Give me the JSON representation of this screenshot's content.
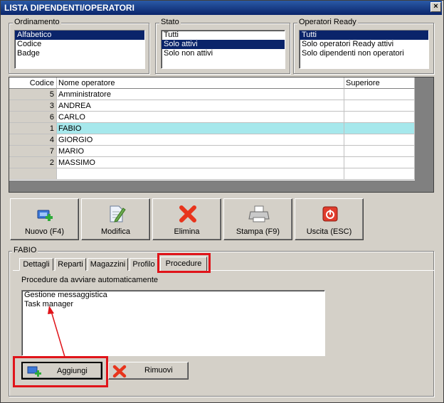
{
  "window": {
    "title": "LISTA DIPENDENTI/OPERATORI",
    "close_glyph": "×"
  },
  "ordinamento": {
    "label": "Ordinamento",
    "items": [
      "Alfabetico",
      "Codice",
      "Badge"
    ],
    "selected": 0
  },
  "stato": {
    "label": "Stato",
    "items": [
      "Tutti",
      "Solo attivi",
      "Solo non attivi"
    ],
    "selected": 1
  },
  "operatori_ready": {
    "label": "Operatori Ready",
    "items": [
      "Tutti",
      "Solo operatori Ready attivi",
      "Solo dipendenti non operatori"
    ],
    "selected": 0
  },
  "table": {
    "columns": [
      "Codice",
      "Nome operatore",
      "Superiore"
    ],
    "rows": [
      {
        "codice": "5",
        "nome": "Amministratore",
        "superiore": ""
      },
      {
        "codice": "3",
        "nome": "ANDREA",
        "superiore": ""
      },
      {
        "codice": "6",
        "nome": "CARLO",
        "superiore": ""
      },
      {
        "codice": "1",
        "nome": "FABIO",
        "superiore": ""
      },
      {
        "codice": "4",
        "nome": "GIORGIO",
        "superiore": ""
      },
      {
        "codice": "7",
        "nome": "MARIO",
        "superiore": ""
      },
      {
        "codice": "2",
        "nome": "MASSIMO",
        "superiore": ""
      }
    ],
    "selected_row": 3,
    "selected_color": "#a6e8ec"
  },
  "toolbar": {
    "nuovo": "Nuovo (F4)",
    "modifica": "Modifica",
    "elimina": "Elimina",
    "stampa": "Stampa (F9)",
    "uscita": "Uscita (ESC)"
  },
  "detail": {
    "label": "FABIO",
    "tabs": [
      "Dettagli",
      "Reparti",
      "Magazzini",
      "Profilo",
      "Procedure"
    ],
    "active_tab": 4,
    "procedures_label": "Procedure da avviare automaticamente",
    "procedures": [
      "Gestione messaggistica",
      "Task manager"
    ],
    "aggiungi": "Aggiungi",
    "rimuovi": "Rimuovi"
  },
  "colors": {
    "highlight": "#e0141a",
    "accent": "#0a246a"
  }
}
